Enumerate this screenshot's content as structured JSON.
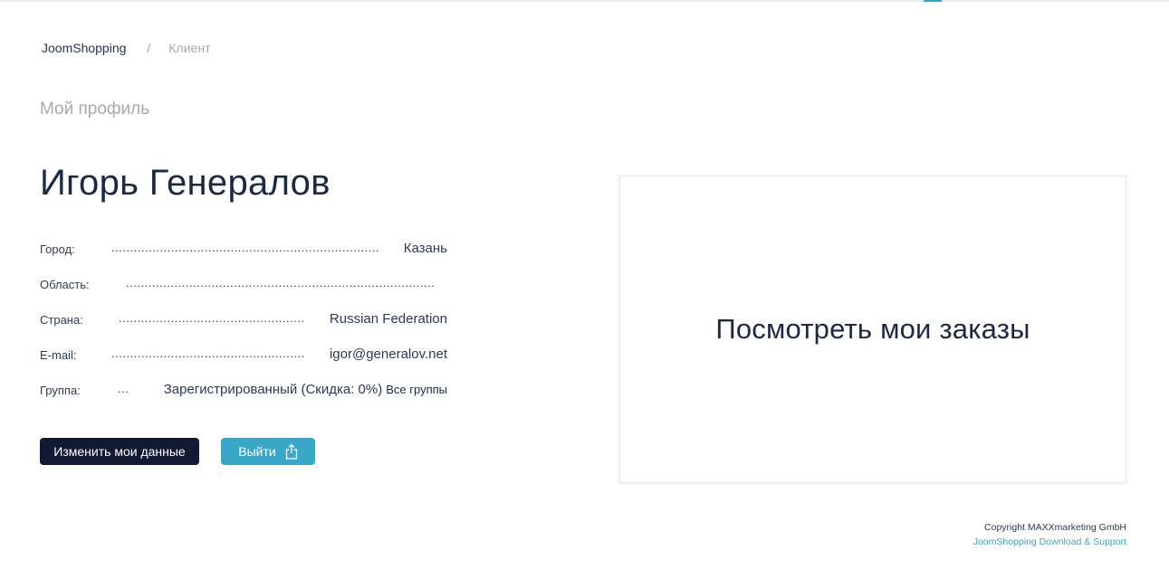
{
  "breadcrumb": {
    "home": "JoomShopping",
    "separator": "/",
    "current": "Клиент"
  },
  "page": {
    "subtitle": "Мой профиль",
    "user_name": "Игорь Генералов"
  },
  "profile": {
    "city": {
      "label": "Город:",
      "dots": "........................................................................",
      "value": "Казань"
    },
    "region": {
      "label": "Область:",
      "dots": "...................................................................................",
      "value": ""
    },
    "country": {
      "label": "Страна:",
      "dots": "..................................................",
      "value": "Russian Federation"
    },
    "email": {
      "label": "E-mail:",
      "dots": "....................................................",
      "value": "igor@generalov.net"
    },
    "group": {
      "label": "Группа:",
      "dots": "...",
      "value": "Зарегистрированный (Скидка: 0%)",
      "link": "Все группы"
    }
  },
  "buttons": {
    "edit": "Изменить мои данные",
    "logout": "Выйти"
  },
  "orders_card": {
    "label": "Посмотреть мои заказы"
  },
  "footer": {
    "copyright": "Copyright MAXXmarketing GmbH",
    "support_link": "JoomShopping Download & Support"
  },
  "colors": {
    "accent": "#39a7c7",
    "dark_button": "#121a33",
    "text_primary": "#1b2846"
  },
  "icons": {
    "logout": "share-export-icon"
  }
}
